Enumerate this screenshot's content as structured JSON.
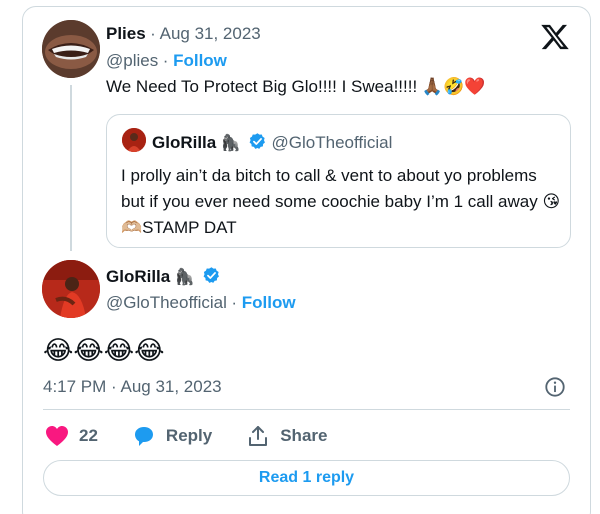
{
  "original_tweet": {
    "author_name": "Plies",
    "date": "Aug 31, 2023",
    "handle": "@plies",
    "separator": "·",
    "follow_label": "Follow",
    "text": "We Need To Protect Big Glo!!!! I Swea!!!!! 🙏🏾🤣❤️"
  },
  "quoted_tweet": {
    "author_name": "GloRilla",
    "author_emoji": "🦍",
    "handle": "@GloTheofficial",
    "text": "I prolly ain’t da bitch to call & vent to about yo problems but if you ever need some coochie baby I’m 1 call away 😘🫶🏼STAMP DAT"
  },
  "reply_tweet": {
    "author_name": "GloRilla",
    "author_emoji": "🦍",
    "handle": "@GloTheofficial",
    "separator": "·",
    "follow_label": "Follow",
    "text": "😂😂😂😂",
    "timestamp": "4:17 PM · Aug 31, 2023"
  },
  "actions": {
    "like_count": "22",
    "reply_label": "Reply",
    "share_label": "Share"
  },
  "read_replies_label": "Read 1 reply",
  "colors": {
    "accent": "#1d9bf0",
    "like": "#f91880",
    "muted": "#536471",
    "border": "#cfd9de"
  },
  "icons": [
    "x-logo-icon",
    "verified-badge-icon",
    "info-icon",
    "heart-icon",
    "reply-bubble-icon",
    "share-icon"
  ]
}
